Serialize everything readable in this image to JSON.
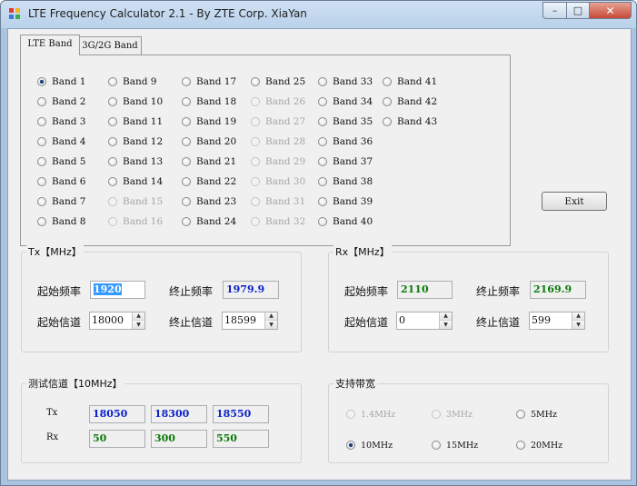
{
  "window": {
    "title": "LTE Frequency Calculator 2.1 - By ZTE Corp. XiaYan",
    "minimize_glyph": "–",
    "maximize_glyph": "□",
    "close_glyph": "✕",
    "icon": "app-grid-icon"
  },
  "tabs": [
    "LTE Band",
    "3G/2G Band"
  ],
  "selected_tab": "LTE Band",
  "lte_bands": [
    {
      "label": "Band 1",
      "state": "checked"
    },
    {
      "label": "Band 2",
      "state": "enabled"
    },
    {
      "label": "Band 3",
      "state": "enabled"
    },
    {
      "label": "Band 4",
      "state": "enabled"
    },
    {
      "label": "Band 5",
      "state": "enabled"
    },
    {
      "label": "Band 6",
      "state": "enabled"
    },
    {
      "label": "Band 7",
      "state": "enabled"
    },
    {
      "label": "Band 8",
      "state": "enabled"
    },
    {
      "label": "Band 9",
      "state": "enabled"
    },
    {
      "label": "Band 10",
      "state": "enabled"
    },
    {
      "label": "Band 11",
      "state": "enabled"
    },
    {
      "label": "Band 12",
      "state": "enabled"
    },
    {
      "label": "Band 13",
      "state": "enabled"
    },
    {
      "label": "Band 14",
      "state": "enabled"
    },
    {
      "label": "Band 15",
      "state": "disabled"
    },
    {
      "label": "Band 16",
      "state": "disabled"
    },
    {
      "label": "Band 17",
      "state": "enabled"
    },
    {
      "label": "Band 18",
      "state": "enabled"
    },
    {
      "label": "Band 19",
      "state": "enabled"
    },
    {
      "label": "Band 20",
      "state": "enabled"
    },
    {
      "label": "Band 21",
      "state": "enabled"
    },
    {
      "label": "Band 22",
      "state": "enabled"
    },
    {
      "label": "Band 23",
      "state": "enabled"
    },
    {
      "label": "Band 24",
      "state": "enabled"
    },
    {
      "label": "Band 25",
      "state": "enabled"
    },
    {
      "label": "Band 26",
      "state": "disabled"
    },
    {
      "label": "Band 27",
      "state": "disabled"
    },
    {
      "label": "Band 28",
      "state": "disabled"
    },
    {
      "label": "Band 29",
      "state": "disabled"
    },
    {
      "label": "Band 30",
      "state": "disabled"
    },
    {
      "label": "Band 31",
      "state": "disabled"
    },
    {
      "label": "Band 32",
      "state": "disabled"
    },
    {
      "label": "Band 33",
      "state": "enabled"
    },
    {
      "label": "Band 34",
      "state": "enabled"
    },
    {
      "label": "Band 35",
      "state": "enabled"
    },
    {
      "label": "Band 36",
      "state": "enabled"
    },
    {
      "label": "Band 37",
      "state": "enabled"
    },
    {
      "label": "Band 38",
      "state": "enabled"
    },
    {
      "label": "Band 39",
      "state": "enabled"
    },
    {
      "label": "Band 40",
      "state": "enabled"
    },
    {
      "label": "Band 41",
      "state": "enabled"
    },
    {
      "label": "Band 42",
      "state": "enabled"
    },
    {
      "label": "Band 43",
      "state": "enabled"
    }
  ],
  "exit_button": "Exit",
  "tx": {
    "title": "Tx【MHz】",
    "start_freq_label": "起始频率",
    "start_freq": "1920",
    "end_freq_label": "终止频率",
    "end_freq": "1979.9",
    "start_channel_label": "起始信道",
    "start_channel": "18000",
    "end_channel_label": "终止信道",
    "end_channel": "18599"
  },
  "rx": {
    "title": "Rx【MHz】",
    "start_freq_label": "起始频率",
    "start_freq": "2110",
    "end_freq_label": "终止频率",
    "end_freq": "2169.9",
    "start_channel_label": "起始信道",
    "start_channel": "0",
    "end_channel_label": "终止信道",
    "end_channel": "599"
  },
  "test_channels": {
    "title": "测试信道【10MHz】",
    "tx_label": "Tx",
    "rx_label": "Rx",
    "tx_values": [
      "18050",
      "18300",
      "18550"
    ],
    "rx_values": [
      "50",
      "300",
      "550"
    ]
  },
  "bandwidth": {
    "title": "支持带宽",
    "options": [
      {
        "label": "1.4MHz",
        "state": "disabled"
      },
      {
        "label": "3MHz",
        "state": "disabled"
      },
      {
        "label": "5MHz",
        "state": "enabled"
      },
      {
        "label": "10MHz",
        "state": "checked"
      },
      {
        "label": "15MHz",
        "state": "enabled"
      },
      {
        "label": "20MHz",
        "state": "enabled"
      }
    ]
  },
  "colors": {
    "value_blue": "#0b22c9",
    "value_green": "#0b7a0b",
    "selection": "#3399ff"
  }
}
